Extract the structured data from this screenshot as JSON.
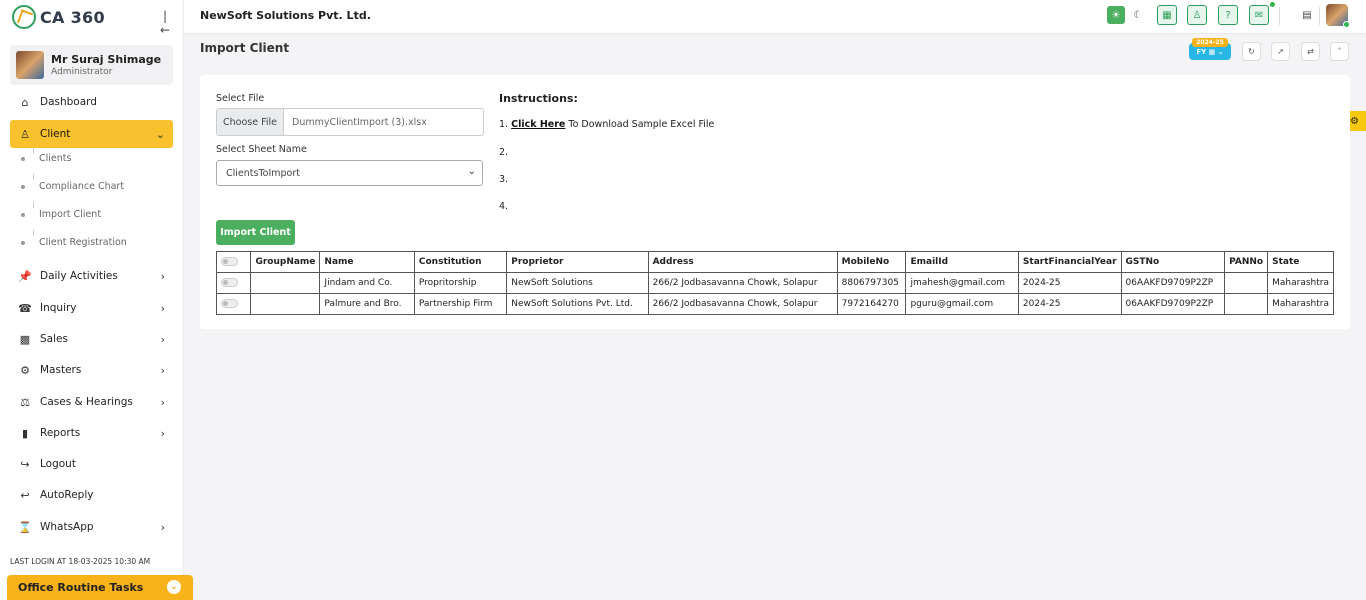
{
  "app": {
    "logo_text": "CA 360",
    "company": "NewSoft Solutions Pvt. Ltd."
  },
  "user": {
    "name": "Mr Suraj Shimage",
    "role": "Administrator"
  },
  "sidebar": {
    "items": [
      {
        "label": "Dashboard",
        "icon": "home-icon"
      },
      {
        "label": "Client",
        "icon": "users-icon"
      },
      {
        "label": "Daily Activities",
        "icon": "pin-icon"
      },
      {
        "label": "Inquiry",
        "icon": "phone-icon"
      },
      {
        "label": "Sales",
        "icon": "cash-icon"
      },
      {
        "label": "Masters",
        "icon": "gears-icon"
      },
      {
        "label": "Cases & Hearings",
        "icon": "scale-icon"
      },
      {
        "label": "Reports",
        "icon": "file-icon"
      },
      {
        "label": "Logout",
        "icon": "logout-icon"
      },
      {
        "label": "AutoReply",
        "icon": "reply-icon"
      },
      {
        "label": "WhatsApp",
        "icon": "hourglass-icon"
      }
    ],
    "client_sub": [
      "Clients",
      "Compliance Chart",
      "Import Client",
      "Client Registration"
    ],
    "last_login": "LAST LOGIN AT 18-03-2025 10:30 AM",
    "routine": "Office Routine Tasks"
  },
  "page": {
    "title": "Import Client",
    "fy_year": "2024-25",
    "fy_label": "FY"
  },
  "form": {
    "select_file_label": "Select File",
    "choose_file": "Choose File",
    "file_name": "DummyClientImport (3).xlsx",
    "sheet_label": "Select Sheet Name",
    "sheet_value": "ClientsToImport",
    "import_button": "Import Client"
  },
  "instructions": {
    "title": "Instructions:",
    "line1_num": "1.",
    "line1_link": "Click Here",
    "line1_rest": "To Download Sample Excel File",
    "line2": "2.",
    "line3": "3.",
    "line4": "4."
  },
  "table": {
    "headers": [
      "GroupName",
      "Name",
      "Constitution",
      "Proprietor",
      "Address",
      "MobileNo",
      "EmailId",
      "StartFinancialYear",
      "GSTNo",
      "PANNo",
      "State"
    ],
    "rows": [
      [
        "",
        "Jindam and Co.",
        "Propritorship",
        "NewSoft Solutions",
        "266/2 Jodbasavanna Chowk, Solapur",
        "8806797305",
        "jmahesh@gmail.com",
        "2024-25",
        "06AAKFD9709P2ZP",
        "",
        "Maharashtra"
      ],
      [
        "",
        "Palmure and Bro.",
        "Partnership Firm",
        "NewSoft Solutions Pvt. Ltd.",
        "266/2 Jodbasavanna Chowk, Solapur",
        "7972164270",
        "pguru@gmail.com",
        "2024-25",
        "06AAKFD9709P2ZP",
        "",
        "Maharashtra"
      ]
    ]
  },
  "colors": {
    "accent": "#f8c12d",
    "green": "#4cae5f",
    "fy_blue": "#27b6e6"
  }
}
